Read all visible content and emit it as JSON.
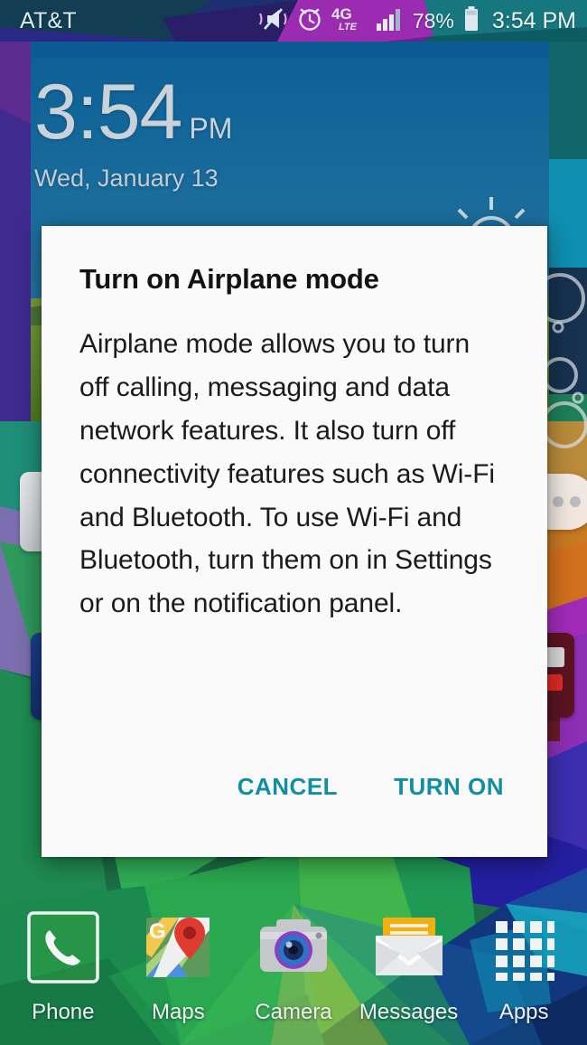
{
  "status_bar": {
    "carrier": "AT&T",
    "battery_percent": "78%",
    "clock": "3:54 PM",
    "icons": [
      {
        "name": "mute-vibrate-icon",
        "glyph": "mute"
      },
      {
        "name": "alarm-clock-icon",
        "glyph": "alarm"
      },
      {
        "name": "4g-lte-icon",
        "label_main": "4G",
        "label_sub": "LTE"
      },
      {
        "name": "signal-bars-icon",
        "glyph": "signal"
      },
      {
        "name": "battery-icon",
        "glyph": "battery"
      }
    ]
  },
  "clock_widget": {
    "time": "3:54",
    "ampm": "PM",
    "date": "Wed, January 13"
  },
  "dialog": {
    "title": "Turn on Airplane mode",
    "message": "Airplane mode allows you to turn off calling, messaging and data network features. It also turn off connectivity features such as Wi-Fi and Bluetooth. To use Wi-Fi and Bluetooth, turn them on in Settings or on the notification panel.",
    "cancel_label": "CANCEL",
    "confirm_label": "TURN ON",
    "accent_color": "#0f8fa3",
    "background_color": "#fafafa"
  },
  "dock": {
    "items": [
      {
        "label": "Phone",
        "icon": "phone-icon"
      },
      {
        "label": "Maps",
        "icon": "maps-icon"
      },
      {
        "label": "Camera",
        "icon": "camera-icon"
      },
      {
        "label": "Messages",
        "icon": "messages-icon"
      },
      {
        "label": "Apps",
        "icon": "apps-grid-icon"
      }
    ]
  },
  "wallpaper": {
    "description": "abstract low-poly geometric wallpaper",
    "colors": [
      "#1d6b44",
      "#2e9e4f",
      "#4db749",
      "#0f5f9c",
      "#2a3f8f",
      "#7a2fa3",
      "#b8328f",
      "#18888e",
      "#1a5c8a"
    ]
  }
}
